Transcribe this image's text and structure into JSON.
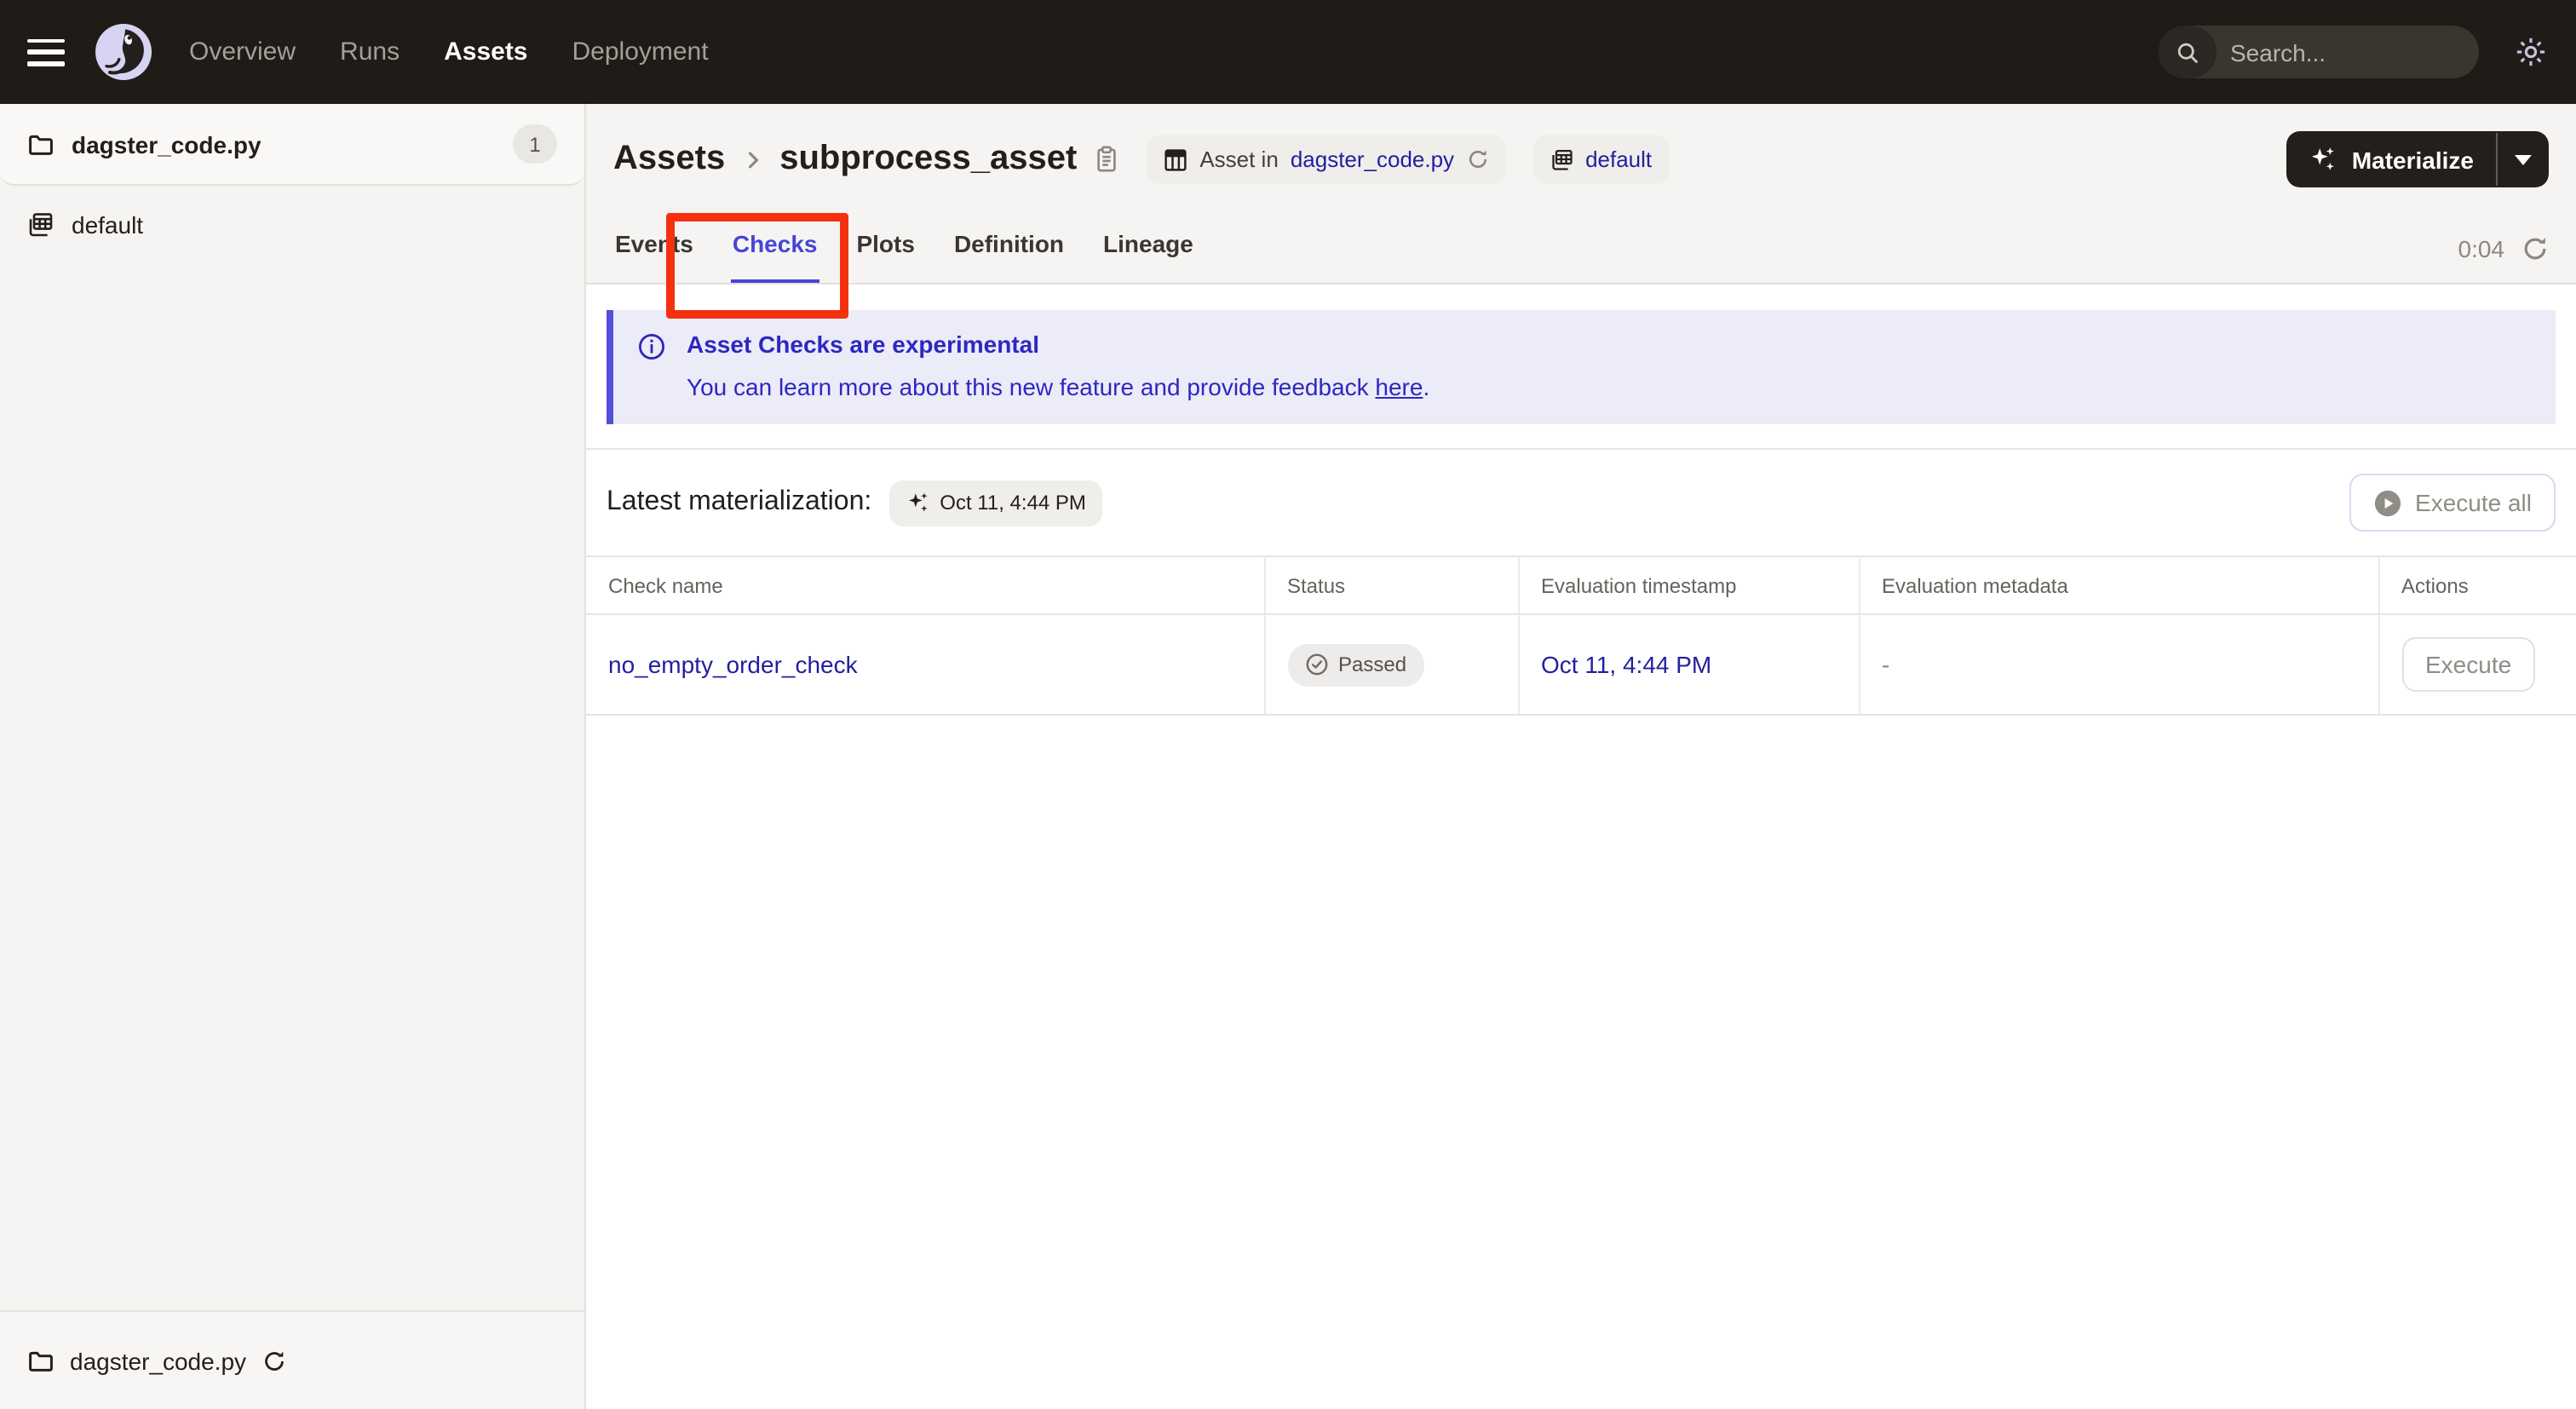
{
  "topbar": {
    "nav_items": [
      "Overview",
      "Runs",
      "Assets",
      "Deployment"
    ],
    "active_nav": "Assets",
    "search_placeholder": "Search...",
    "search_shortcut": "/"
  },
  "sidebar": {
    "items": [
      {
        "label": "dagster_code.py",
        "count": "1",
        "icon": "folder-icon"
      },
      {
        "label": "default",
        "icon": "asset-group-icon"
      }
    ],
    "footer_label": "dagster_code.py"
  },
  "header": {
    "breadcrumb": [
      "Assets",
      "subprocess_asset"
    ],
    "badge_asset_prefix": "Asset in",
    "badge_asset_link": "dagster_code.py",
    "badge_group": "default",
    "materialize_label": "Materialize"
  },
  "tabs": {
    "items": [
      "Events",
      "Checks",
      "Plots",
      "Definition",
      "Lineage"
    ],
    "active": "Checks",
    "timer": "0:04"
  },
  "banner": {
    "title": "Asset Checks are experimental",
    "body": "You can learn more about this new feature and provide feedback ",
    "link_text": "here",
    "suffix": "."
  },
  "latest": {
    "label": "Latest materialization:",
    "value": "Oct 11, 4:44 PM",
    "execute_all_label": "Execute all"
  },
  "table": {
    "columns": [
      "Check name",
      "Status",
      "Evaluation timestamp",
      "Evaluation metadata",
      "Actions"
    ],
    "rows": [
      {
        "name": "no_empty_order_check",
        "status": "Passed",
        "timestamp": "Oct 11, 4:44 PM",
        "metadata": "-",
        "action_label": "Execute"
      }
    ]
  },
  "colors": {
    "topbar_bg": "#1f1b17",
    "accent_indigo": "#4644d8",
    "link_indigo": "#221f9e",
    "banner_bg": "#ecebf8",
    "annotation_red": "#f5300f",
    "sidebar_bg": "#f5f4f2"
  }
}
